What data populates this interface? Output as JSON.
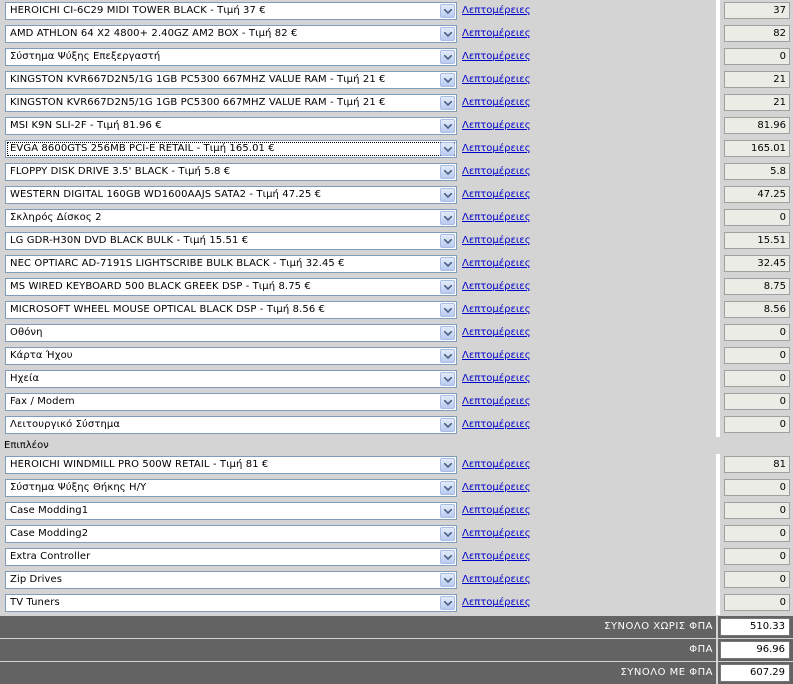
{
  "components": [
    {
      "selected": "HEROICHI CI-6C29 MIDI TOWER BLACK - Τιμή 37 €",
      "details": "Λεπτομέρειες",
      "price": "37"
    },
    {
      "selected": "AMD ATHLON 64 X2 4800+ 2.40GZ AM2 BOX - Τιμή 82 €",
      "details": "Λεπτομέρειες",
      "price": "82"
    },
    {
      "selected": "Σύστημα Ψύξης Επεξεργαστή",
      "details": "Λεπτομέρειες",
      "price": "0"
    },
    {
      "selected": "KINGSTON KVR667D2N5/1G 1GB PC5300 667MHZ VALUE RAM - Τιμή 21 €",
      "details": "Λεπτομέρειες",
      "price": "21"
    },
    {
      "selected": "KINGSTON KVR667D2N5/1G 1GB PC5300 667MHZ VALUE RAM - Τιμή 21 €",
      "details": "Λεπτομέρειες",
      "price": "21"
    },
    {
      "selected": "MSI K9N SLI-2F - Τιμή 81.96 €",
      "details": "Λεπτομέρειες",
      "price": "81.96"
    },
    {
      "selected": "EVGA 8600GTS 256MB PCI-E RETAIL - Τιμή 165.01 €",
      "details": "Λεπτομέρειες",
      "price": "165.01",
      "focused": true
    },
    {
      "selected": "FLOPPY DISK DRIVE 3.5' BLACK - Τιμή 5.8 €",
      "details": "Λεπτομέρειες",
      "price": "5.8"
    },
    {
      "selected": "WESTERN DIGITAL 160GB WD1600AAJS SATA2 - Τιμή 47.25 €",
      "details": "Λεπτομέρειες",
      "price": "47.25"
    },
    {
      "selected": "Σκληρός Δίσκος 2",
      "details": "Λεπτομέρειες",
      "price": "0"
    },
    {
      "selected": "LG GDR-H30N DVD BLACK BULK - Τιμή 15.51 €",
      "details": "Λεπτομέρειες",
      "price": "15.51"
    },
    {
      "selected": "NEC OPTIARC AD-7191S LIGHTSCRIBE BULK BLACK - Τιμή 32.45 €",
      "details": "Λεπτομέρειες",
      "price": "32.45"
    },
    {
      "selected": "MS WIRED KEYBOARD 500 BLACK GREEK DSP - Τιμή 8.75 €",
      "details": "Λεπτομέρειες",
      "price": "8.75"
    },
    {
      "selected": "MICROSOFT WHEEL MOUSE OPTICAL BLACK DSP - Τιμή 8.56 €",
      "details": "Λεπτομέρειες",
      "price": "8.56"
    },
    {
      "selected": "Οθόνη",
      "details": "Λεπτομέρειες",
      "price": "0"
    },
    {
      "selected": "Κάρτα Ήχου",
      "details": "Λεπτομέρειες",
      "price": "0"
    },
    {
      "selected": "Ηχεία",
      "details": "Λεπτομέρειες",
      "price": "0"
    },
    {
      "selected": "Fax / Modem",
      "details": "Λεπτομέρειες",
      "price": "0"
    },
    {
      "selected": "Λειτουργικό Σύστημα",
      "details": "Λεπτομέρειες",
      "price": "0"
    }
  ],
  "extras_heading": "Επιπλέον",
  "extras": [
    {
      "selected": "HEROICHI WINDMILL PRO 500W RETAIL - Τιμή 81 €",
      "details": "Λεπτομέρειες",
      "price": "81"
    },
    {
      "selected": "Σύστημα Ψύξης Θήκης Η/Υ",
      "details": "Λεπτομέρειες",
      "price": "0"
    },
    {
      "selected": "Case Modding1",
      "details": "Λεπτομέρειες",
      "price": "0"
    },
    {
      "selected": "Case Modding2",
      "details": "Λεπτομέρειες",
      "price": "0"
    },
    {
      "selected": "Extra Controller",
      "details": "Λεπτομέρειες",
      "price": "0"
    },
    {
      "selected": "Zip Drives",
      "details": "Λεπτομέρειες",
      "price": "0"
    },
    {
      "selected": "TV Tuners",
      "details": "Λεπτομέρειες",
      "price": "0"
    }
  ],
  "totals": [
    {
      "label": "ΣΥΝΟΛΟ ΧΩΡΙΣ ΦΠΑ",
      "value": "510.33"
    },
    {
      "label": "ΦΠΑ",
      "value": "96.96"
    },
    {
      "label": "ΣΥΝΟΛΟ ΜΕ ΦΠΑ",
      "value": "607.29"
    }
  ],
  "icons": {
    "dropdown": "chevron-down-icon"
  }
}
